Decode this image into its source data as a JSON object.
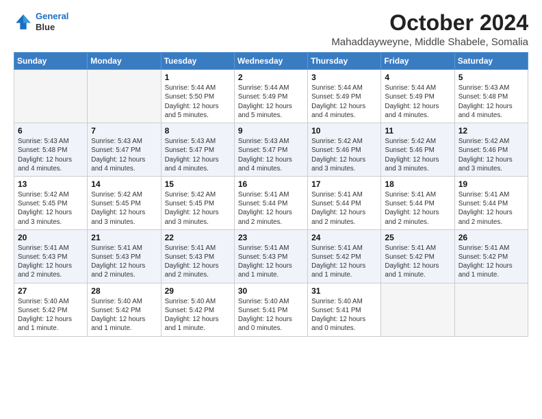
{
  "header": {
    "logo_line1": "General",
    "logo_line2": "Blue",
    "month": "October 2024",
    "location": "Mahaddayweyne, Middle Shabele, Somalia"
  },
  "weekdays": [
    "Sunday",
    "Monday",
    "Tuesday",
    "Wednesday",
    "Thursday",
    "Friday",
    "Saturday"
  ],
  "weeks": [
    [
      {
        "day": "",
        "empty": true
      },
      {
        "day": "",
        "empty": true
      },
      {
        "day": "1",
        "sunrise": "Sunrise: 5:44 AM",
        "sunset": "Sunset: 5:50 PM",
        "daylight": "Daylight: 12 hours and 5 minutes."
      },
      {
        "day": "2",
        "sunrise": "Sunrise: 5:44 AM",
        "sunset": "Sunset: 5:49 PM",
        "daylight": "Daylight: 12 hours and 5 minutes."
      },
      {
        "day": "3",
        "sunrise": "Sunrise: 5:44 AM",
        "sunset": "Sunset: 5:49 PM",
        "daylight": "Daylight: 12 hours and 4 minutes."
      },
      {
        "day": "4",
        "sunrise": "Sunrise: 5:44 AM",
        "sunset": "Sunset: 5:49 PM",
        "daylight": "Daylight: 12 hours and 4 minutes."
      },
      {
        "day": "5",
        "sunrise": "Sunrise: 5:43 AM",
        "sunset": "Sunset: 5:48 PM",
        "daylight": "Daylight: 12 hours and 4 minutes."
      }
    ],
    [
      {
        "day": "6",
        "sunrise": "Sunrise: 5:43 AM",
        "sunset": "Sunset: 5:48 PM",
        "daylight": "Daylight: 12 hours and 4 minutes."
      },
      {
        "day": "7",
        "sunrise": "Sunrise: 5:43 AM",
        "sunset": "Sunset: 5:47 PM",
        "daylight": "Daylight: 12 hours and 4 minutes."
      },
      {
        "day": "8",
        "sunrise": "Sunrise: 5:43 AM",
        "sunset": "Sunset: 5:47 PM",
        "daylight": "Daylight: 12 hours and 4 minutes."
      },
      {
        "day": "9",
        "sunrise": "Sunrise: 5:43 AM",
        "sunset": "Sunset: 5:47 PM",
        "daylight": "Daylight: 12 hours and 4 minutes."
      },
      {
        "day": "10",
        "sunrise": "Sunrise: 5:42 AM",
        "sunset": "Sunset: 5:46 PM",
        "daylight": "Daylight: 12 hours and 3 minutes."
      },
      {
        "day": "11",
        "sunrise": "Sunrise: 5:42 AM",
        "sunset": "Sunset: 5:46 PM",
        "daylight": "Daylight: 12 hours and 3 minutes."
      },
      {
        "day": "12",
        "sunrise": "Sunrise: 5:42 AM",
        "sunset": "Sunset: 5:46 PM",
        "daylight": "Daylight: 12 hours and 3 minutes."
      }
    ],
    [
      {
        "day": "13",
        "sunrise": "Sunrise: 5:42 AM",
        "sunset": "Sunset: 5:45 PM",
        "daylight": "Daylight: 12 hours and 3 minutes."
      },
      {
        "day": "14",
        "sunrise": "Sunrise: 5:42 AM",
        "sunset": "Sunset: 5:45 PM",
        "daylight": "Daylight: 12 hours and 3 minutes."
      },
      {
        "day": "15",
        "sunrise": "Sunrise: 5:42 AM",
        "sunset": "Sunset: 5:45 PM",
        "daylight": "Daylight: 12 hours and 3 minutes."
      },
      {
        "day": "16",
        "sunrise": "Sunrise: 5:41 AM",
        "sunset": "Sunset: 5:44 PM",
        "daylight": "Daylight: 12 hours and 2 minutes."
      },
      {
        "day": "17",
        "sunrise": "Sunrise: 5:41 AM",
        "sunset": "Sunset: 5:44 PM",
        "daylight": "Daylight: 12 hours and 2 minutes."
      },
      {
        "day": "18",
        "sunrise": "Sunrise: 5:41 AM",
        "sunset": "Sunset: 5:44 PM",
        "daylight": "Daylight: 12 hours and 2 minutes."
      },
      {
        "day": "19",
        "sunrise": "Sunrise: 5:41 AM",
        "sunset": "Sunset: 5:44 PM",
        "daylight": "Daylight: 12 hours and 2 minutes."
      }
    ],
    [
      {
        "day": "20",
        "sunrise": "Sunrise: 5:41 AM",
        "sunset": "Sunset: 5:43 PM",
        "daylight": "Daylight: 12 hours and 2 minutes."
      },
      {
        "day": "21",
        "sunrise": "Sunrise: 5:41 AM",
        "sunset": "Sunset: 5:43 PM",
        "daylight": "Daylight: 12 hours and 2 minutes."
      },
      {
        "day": "22",
        "sunrise": "Sunrise: 5:41 AM",
        "sunset": "Sunset: 5:43 PM",
        "daylight": "Daylight: 12 hours and 2 minutes."
      },
      {
        "day": "23",
        "sunrise": "Sunrise: 5:41 AM",
        "sunset": "Sunset: 5:43 PM",
        "daylight": "Daylight: 12 hours and 1 minute."
      },
      {
        "day": "24",
        "sunrise": "Sunrise: 5:41 AM",
        "sunset": "Sunset: 5:42 PM",
        "daylight": "Daylight: 12 hours and 1 minute."
      },
      {
        "day": "25",
        "sunrise": "Sunrise: 5:41 AM",
        "sunset": "Sunset: 5:42 PM",
        "daylight": "Daylight: 12 hours and 1 minute."
      },
      {
        "day": "26",
        "sunrise": "Sunrise: 5:41 AM",
        "sunset": "Sunset: 5:42 PM",
        "daylight": "Daylight: 12 hours and 1 minute."
      }
    ],
    [
      {
        "day": "27",
        "sunrise": "Sunrise: 5:40 AM",
        "sunset": "Sunset: 5:42 PM",
        "daylight": "Daylight: 12 hours and 1 minute."
      },
      {
        "day": "28",
        "sunrise": "Sunrise: 5:40 AM",
        "sunset": "Sunset: 5:42 PM",
        "daylight": "Daylight: 12 hours and 1 minute."
      },
      {
        "day": "29",
        "sunrise": "Sunrise: 5:40 AM",
        "sunset": "Sunset: 5:42 PM",
        "daylight": "Daylight: 12 hours and 1 minute."
      },
      {
        "day": "30",
        "sunrise": "Sunrise: 5:40 AM",
        "sunset": "Sunset: 5:41 PM",
        "daylight": "Daylight: 12 hours and 0 minutes."
      },
      {
        "day": "31",
        "sunrise": "Sunrise: 5:40 AM",
        "sunset": "Sunset: 5:41 PM",
        "daylight": "Daylight: 12 hours and 0 minutes."
      },
      {
        "day": "",
        "empty": true
      },
      {
        "day": "",
        "empty": true
      }
    ]
  ]
}
